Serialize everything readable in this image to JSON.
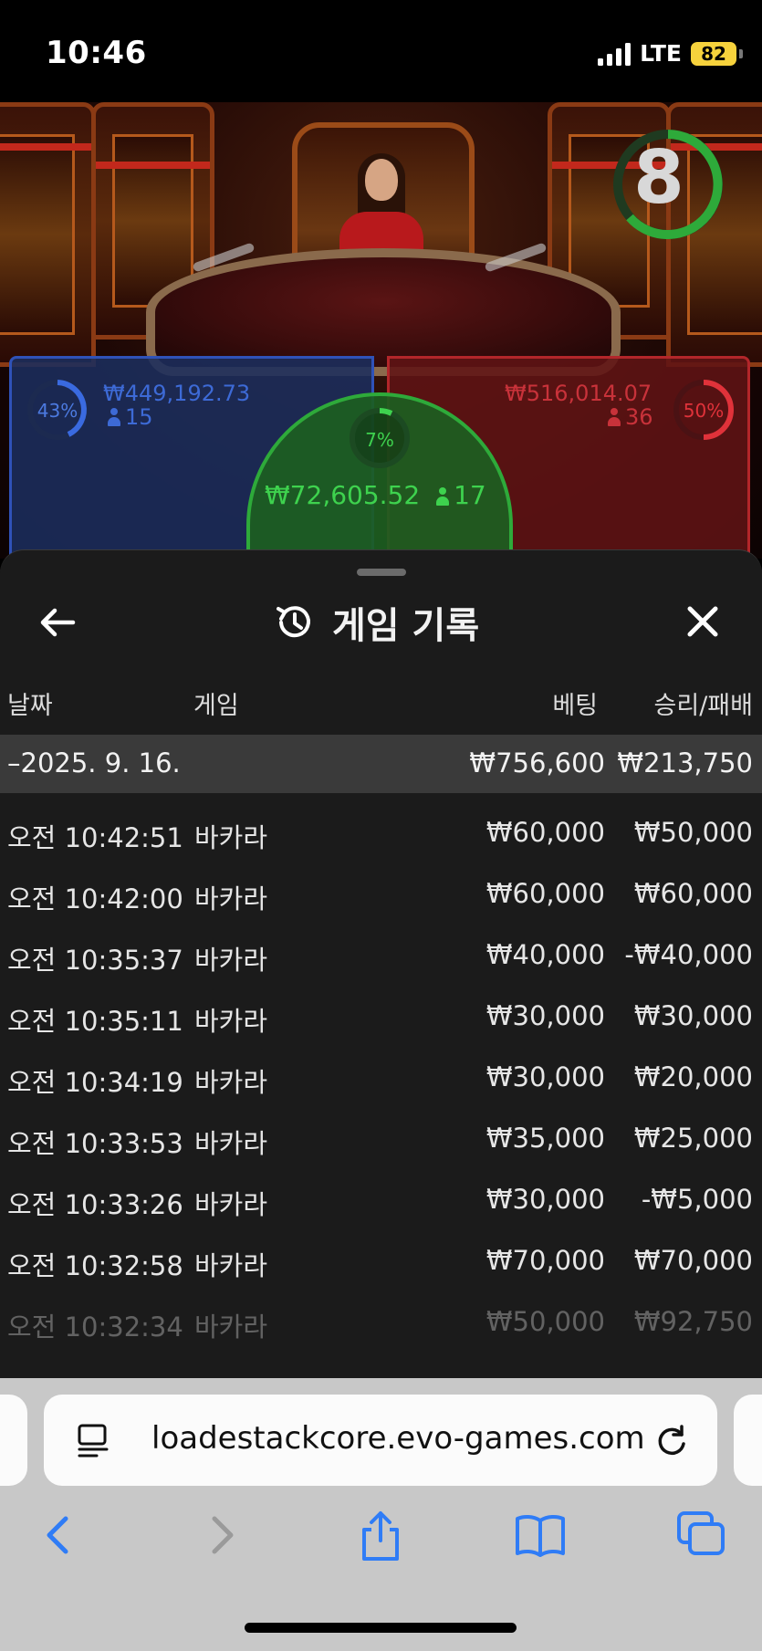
{
  "status_bar": {
    "time": "10:46",
    "network": "LTE",
    "battery": "82"
  },
  "game": {
    "timer": "8",
    "player": {
      "percent": "43%",
      "amount": "₩449,192.73",
      "players": "15",
      "color": "#2f52b8"
    },
    "tie": {
      "percent": "7%",
      "amount": "₩72,605.52",
      "players": "17",
      "color": "#2eaa3a"
    },
    "banker": {
      "percent": "50%",
      "amount": "₩516,014.07",
      "players": "36",
      "color": "#b2262a"
    }
  },
  "panel": {
    "title": "게임 기록",
    "columns": {
      "date": "날짜",
      "game": "게임",
      "bet": "베팅",
      "result": "승리/패배"
    },
    "date_group": {
      "date": "–2025. 9. 16.",
      "bet_total": "₩756,600",
      "result_total": "₩213,750"
    },
    "rows": [
      {
        "time": "오전 10:42:51",
        "game": "바카라",
        "bet": "₩60,000",
        "result": "₩50,000"
      },
      {
        "time": "오전 10:42:00",
        "game": "바카라",
        "bet": "₩60,000",
        "result": "₩60,000"
      },
      {
        "time": "오전 10:35:37",
        "game": "바카라",
        "bet": "₩40,000",
        "result": "-₩40,000"
      },
      {
        "time": "오전 10:35:11",
        "game": "바카라",
        "bet": "₩30,000",
        "result": "₩30,000"
      },
      {
        "time": "오전 10:34:19",
        "game": "바카라",
        "bet": "₩30,000",
        "result": "₩20,000"
      },
      {
        "time": "오전 10:33:53",
        "game": "바카라",
        "bet": "₩35,000",
        "result": "₩25,000"
      },
      {
        "time": "오전 10:33:26",
        "game": "바카라",
        "bet": "₩30,000",
        "result": "-₩5,000"
      },
      {
        "time": "오전 10:32:58",
        "game": "바카라",
        "bet": "₩70,000",
        "result": "₩70,000"
      },
      {
        "time": "오전 10:32:34",
        "game": "바카라",
        "bet": "₩50,000",
        "result": "₩92,750"
      }
    ]
  },
  "browser": {
    "url": "loadestackcore.evo-games.com"
  }
}
